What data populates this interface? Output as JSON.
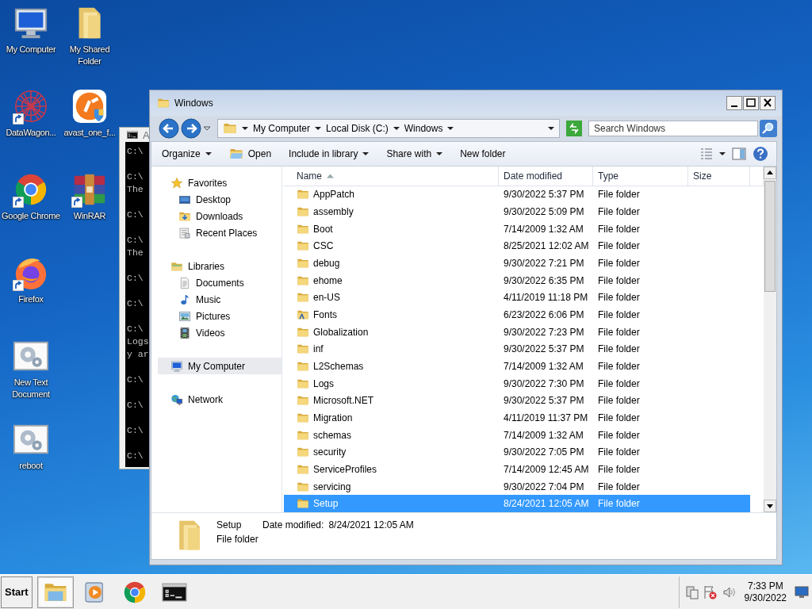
{
  "desktop_icons": [
    {
      "label": "My Computer",
      "kind": "computer",
      "shortcut": false
    },
    {
      "label": "DataWagon...",
      "kind": "datawagon",
      "shortcut": true
    },
    {
      "label": "Google Chrome",
      "kind": "chrome",
      "shortcut": true
    },
    {
      "label": "Firefox",
      "kind": "firefox",
      "shortcut": true
    },
    {
      "label": "New Text Document",
      "kind": "script",
      "shortcut": false
    },
    {
      "label": "reboot",
      "kind": "script",
      "shortcut": false
    },
    {
      "label": "My Shared Folder",
      "kind": "bigfolder",
      "shortcut": false
    },
    {
      "label": "avast_one_f...",
      "kind": "avast",
      "shortcut": false
    },
    {
      "label": "WinRAR",
      "kind": "winrar",
      "shortcut": true
    }
  ],
  "console_window": {
    "title": "A",
    "blocks": [
      [
        "C:\\"
      ],
      [
        "C:\\",
        "The"
      ],
      [
        "C:\\"
      ],
      [
        "C:\\",
        "The"
      ],
      [
        "C:\\"
      ],
      [
        "C:\\"
      ],
      [
        "C:\\",
        "Logs",
        "y ar"
      ],
      [
        "C:\\"
      ],
      [
        "C:\\"
      ],
      [
        "C:\\"
      ],
      [
        "C:\\"
      ]
    ]
  },
  "explorer": {
    "title": "Windows",
    "breadcrumb": [
      "My Computer",
      "Local Disk (C:)",
      "Windows"
    ],
    "search": {
      "placeholder": "Search Windows"
    },
    "toolbar": [
      {
        "label": "Organize",
        "kind": "menu"
      },
      {
        "label": "Open",
        "kind": "icon"
      },
      {
        "label": "Include in library",
        "kind": "menu"
      },
      {
        "label": "Share with",
        "kind": "menu"
      },
      {
        "label": "New folder",
        "kind": "plain"
      }
    ],
    "nav": [
      {
        "label": "Favorites",
        "kind": "star",
        "selected": false,
        "children": [
          {
            "label": "Desktop",
            "kind": "desktop",
            "selected": false
          },
          {
            "label": "Downloads",
            "kind": "downloads",
            "selected": false
          },
          {
            "label": "Recent Places",
            "kind": "recent",
            "selected": false
          }
        ]
      },
      {
        "label": "Libraries",
        "kind": "libraries",
        "selected": false,
        "children": [
          {
            "label": "Documents",
            "kind": "documents",
            "selected": false
          },
          {
            "label": "Music",
            "kind": "music",
            "selected": false
          },
          {
            "label": "Pictures",
            "kind": "pictures",
            "selected": false
          },
          {
            "label": "Videos",
            "kind": "videos",
            "selected": false
          }
        ]
      },
      {
        "label": "My Computer",
        "kind": "computer",
        "selected": true
      },
      {
        "label": "Network",
        "kind": "network",
        "selected": false
      }
    ],
    "columns": [
      {
        "label": "Name",
        "sorted": true
      },
      {
        "label": "Date modified",
        "sorted": false
      },
      {
        "label": "Type",
        "sorted": false
      },
      {
        "label": "Size",
        "sorted": false
      }
    ],
    "rows": [
      {
        "name": "AppPatch",
        "date": "9/30/2022 5:37 PM",
        "type": "File folder",
        "kind": "folder",
        "selected": false
      },
      {
        "name": "assembly",
        "date": "9/30/2022 5:09 PM",
        "type": "File folder",
        "kind": "folder",
        "selected": false
      },
      {
        "name": "Boot",
        "date": "7/14/2009 1:32 AM",
        "type": "File folder",
        "kind": "folder",
        "selected": false
      },
      {
        "name": "CSC",
        "date": "8/25/2021 12:02 AM",
        "type": "File folder",
        "kind": "folder",
        "selected": false
      },
      {
        "name": "debug",
        "date": "9/30/2022 7:21 PM",
        "type": "File folder",
        "kind": "folder",
        "selected": false
      },
      {
        "name": "ehome",
        "date": "9/30/2022 6:35 PM",
        "type": "File folder",
        "kind": "folder",
        "selected": false
      },
      {
        "name": "en-US",
        "date": "4/11/2019 11:18 PM",
        "type": "File folder",
        "kind": "folder",
        "selected": false
      },
      {
        "name": "Fonts",
        "date": "6/23/2022 6:06 PM",
        "type": "File folder",
        "kind": "fonts",
        "selected": false
      },
      {
        "name": "Globalization",
        "date": "9/30/2022 7:23 PM",
        "type": "File folder",
        "kind": "folder",
        "selected": false
      },
      {
        "name": "inf",
        "date": "9/30/2022 5:37 PM",
        "type": "File folder",
        "kind": "folder",
        "selected": false
      },
      {
        "name": "L2Schemas",
        "date": "7/14/2009 1:32 AM",
        "type": "File folder",
        "kind": "folder",
        "selected": false
      },
      {
        "name": "Logs",
        "date": "9/30/2022 7:30 PM",
        "type": "File folder",
        "kind": "folder",
        "selected": false
      },
      {
        "name": "Microsoft.NET",
        "date": "9/30/2022 5:37 PM",
        "type": "File folder",
        "kind": "folder",
        "selected": false
      },
      {
        "name": "Migration",
        "date": "4/11/2019 11:37 PM",
        "type": "File folder",
        "kind": "folder",
        "selected": false
      },
      {
        "name": "schemas",
        "date": "7/14/2009 1:32 AM",
        "type": "File folder",
        "kind": "folder",
        "selected": false
      },
      {
        "name": "security",
        "date": "9/30/2022 7:05 PM",
        "type": "File folder",
        "kind": "folder",
        "selected": false
      },
      {
        "name": "ServiceProfiles",
        "date": "7/14/2009 12:45 AM",
        "type": "File folder",
        "kind": "folder",
        "selected": false
      },
      {
        "name": "servicing",
        "date": "9/30/2022 7:04 PM",
        "type": "File folder",
        "kind": "folder",
        "selected": false
      },
      {
        "name": "Setup",
        "date": "8/24/2021 12:05 AM",
        "type": "File folder",
        "kind": "folder",
        "selected": true
      }
    ],
    "details": {
      "name": "Setup",
      "type": "File folder",
      "date_label": "Date modified:",
      "date": "8/24/2021 12:05 AM"
    }
  },
  "taskbar": {
    "start": "Start",
    "apps": [
      {
        "kind": "explorer",
        "active": true
      },
      {
        "kind": "media",
        "active": false
      },
      {
        "kind": "chrome",
        "active": false
      },
      {
        "kind": "console",
        "active": false
      }
    ],
    "time": "7:33 PM",
    "date": "9/30/2022"
  }
}
